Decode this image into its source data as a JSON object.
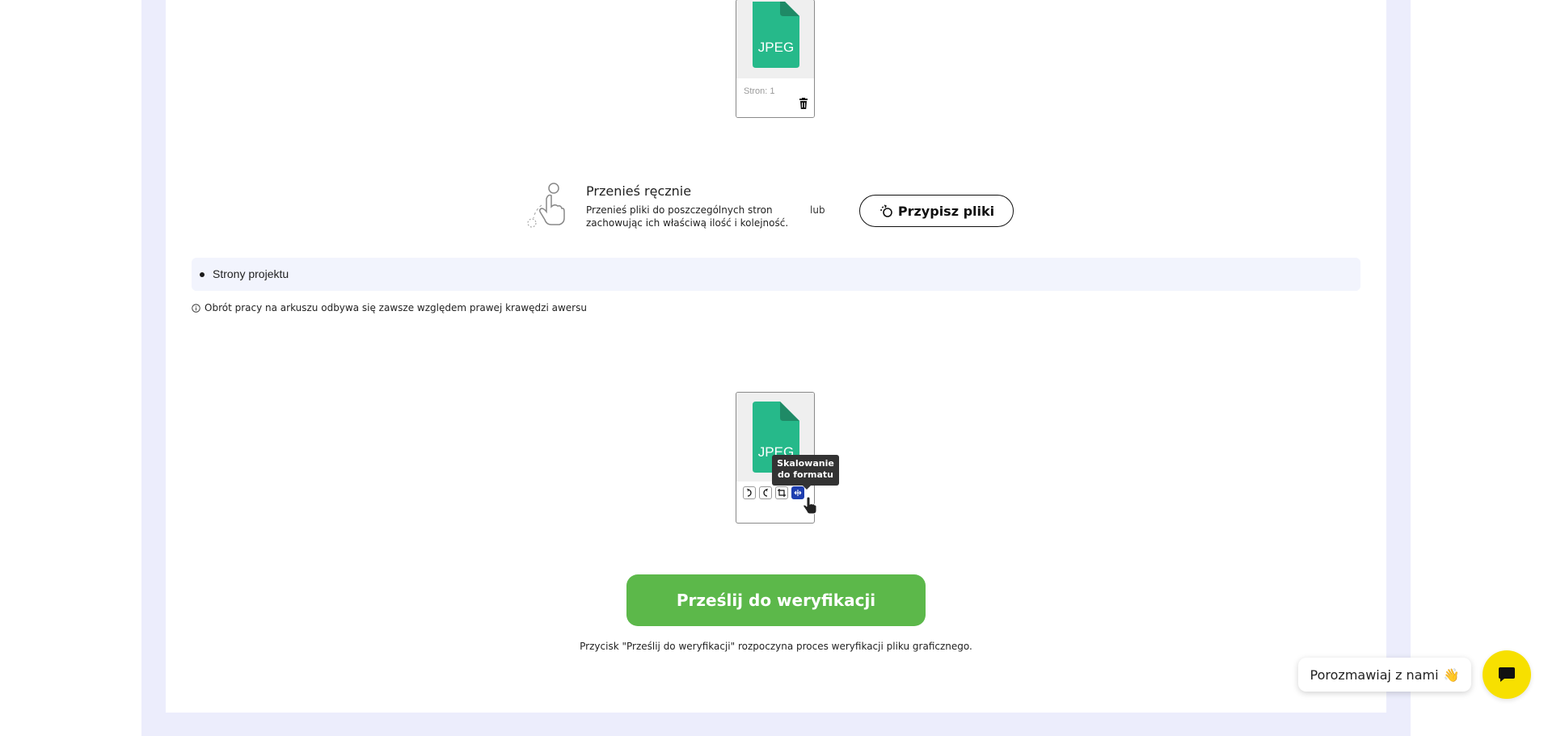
{
  "file_cards": [
    {
      "type_label": "JPEG",
      "pages_label": "Stron: 1"
    },
    {
      "type_label": "JPEG"
    }
  ],
  "manual": {
    "title": "Przenieś ręcznie",
    "description": "Przenieś pliki do poszczególnych stron zachowując ich właściwą ilość i kolejność.",
    "or_label": "lub",
    "assign_button": "Przypisz pliki"
  },
  "project_pages": {
    "label": "Strony projektu"
  },
  "info_note": "Obrót pracy na arkuszu odbywa się zawsze względem prawej krawędzi awersu",
  "tools": {
    "items": [
      {
        "name": "rotate-right-icon"
      },
      {
        "name": "rotate-left-icon"
      },
      {
        "name": "crop-icon"
      },
      {
        "name": "scale-to-format-icon",
        "active": true
      }
    ],
    "tooltip": "Skalowanie do formatu"
  },
  "submit": {
    "button": "Prześlij do weryfikacji",
    "note": "Przycisk \"Prześlij do weryfikacji\" rozpoczyna proces weryfikacji pliku graficznego."
  },
  "chat": {
    "label": "Porozmawiaj z nami",
    "emoji": "👋"
  },
  "colors": {
    "band": "#ecedfc",
    "jpeg_green": "#26b98a",
    "submit_green": "#5cb84a",
    "tool_active": "#1f3fb0",
    "chat_yellow": "#f7e000"
  }
}
